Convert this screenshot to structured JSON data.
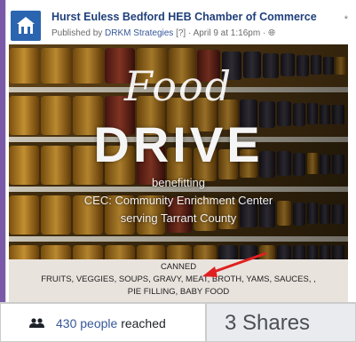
{
  "post": {
    "page_name": "Hurst Euless Bedford HEB Chamber of Commerce",
    "published_prefix": "Published by",
    "publisher": "DRKM Strategies",
    "publisher_count": "[?]",
    "date": "April 9 at 1:16pm"
  },
  "image": {
    "title_food": "Food",
    "title_drive": "DRIVE",
    "line1": "benefitting",
    "line2": "CEC: Community Enrichment Center",
    "line3": "serving Tarrant County",
    "canned_heading": "CANNED",
    "canned_list_1": "FRUITS, VEGGIES, SOUPS, GRAVY, MEAT, BROTH, YAMS, SAUCES, ,",
    "canned_list_2": "PIE FILLING, BABY FOOD"
  },
  "stats": {
    "reach_count": "430 people",
    "reach_label": "reached",
    "shares": "3 Shares"
  },
  "colors": {
    "accent": "#7a5aa8",
    "link": "#365899",
    "arrow": "#e02020"
  }
}
